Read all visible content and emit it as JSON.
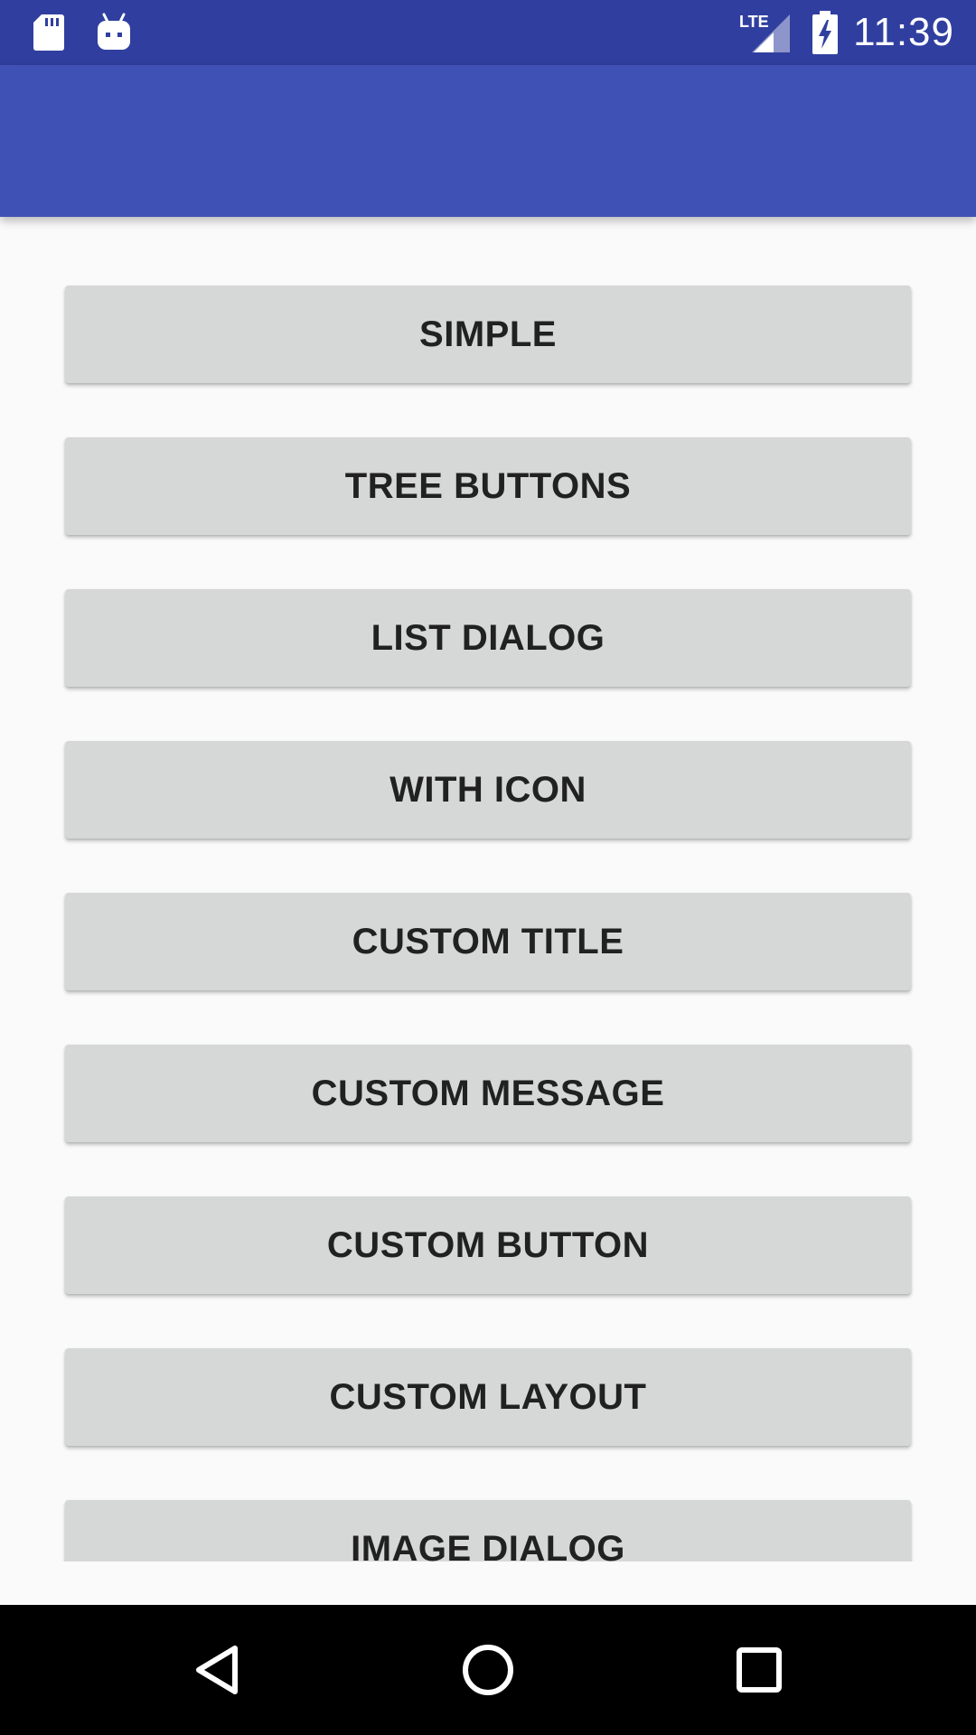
{
  "status_bar": {
    "time": "11:39",
    "network_label": "LTE",
    "icons": [
      "sd-card-icon",
      "android-debug-icon",
      "lte-signal-icon",
      "battery-charging-icon"
    ],
    "background_color": "#303f9f"
  },
  "app_bar": {
    "background_color": "#3f51b5"
  },
  "buttons": [
    {
      "label": "SIMPLE"
    },
    {
      "label": "TREE BUTTONS"
    },
    {
      "label": "LIST DIALOG"
    },
    {
      "label": "WITH ICON"
    },
    {
      "label": "CUSTOM TITLE"
    },
    {
      "label": "CUSTOM MESSAGE"
    },
    {
      "label": "CUSTOM BUTTON"
    },
    {
      "label": "CUSTOM LAYOUT"
    },
    {
      "label": "IMAGE DIALOG"
    }
  ],
  "navigation_bar": {
    "items": [
      "back-icon",
      "home-icon",
      "recents-icon"
    ],
    "background_color": "#000000"
  }
}
